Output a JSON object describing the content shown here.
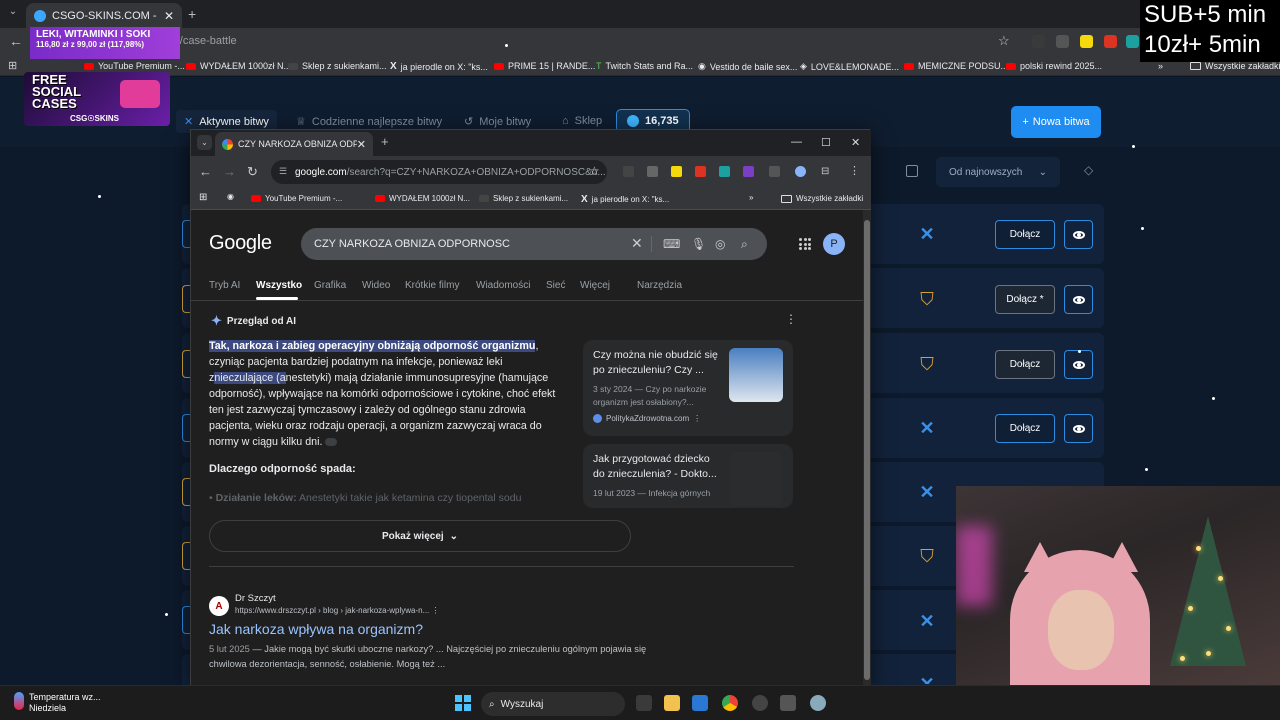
{
  "overlay": {
    "line1": "SUB+5 min",
    "line2": "10zł+ 5min"
  },
  "outer_browser": {
    "tab_title": "CSGO-SKINS.COM - Najlepsze",
    "url": "csgo-skins.com/case-battle",
    "bookmarks": [
      "YouTube Premium -...",
      "WYDAŁEM 1000zł N...",
      "Sklep z sukienkami...",
      "ja pierodle on X: \"ks...",
      "PRIME 15 | RANDE...",
      "Twitch Stats and Ra...",
      "Vestido de baile sex...",
      "LOVE&LEMONADE...",
      "MEMICZNE PODSU...",
      "polski rewind 2025..."
    ],
    "all_bookmarks": "Wszystkie zakładki"
  },
  "stream_banner": {
    "title": "LEKI, WITAMINKI I SOKI",
    "goal": "116,80 zł z 99,00 zł (117,98%)"
  },
  "promo": {
    "line1": "FREE",
    "line2": "SOCIAL",
    "line3": "CASES",
    "brand": "CSG☉SKINS"
  },
  "site": {
    "nav": [
      "Aktywne bitwy",
      "Codzienne najlepsze bitwy",
      "Moje bitwy",
      "Sklep"
    ],
    "balance": "16,735",
    "new_battle": "Nowa bitwa",
    "sort": "Od najnowszych",
    "join_label": "Dołącz",
    "join_label_alt": "Dołącz *"
  },
  "inner_browser": {
    "tab_title": "CZY NARKOZA OBNIZA ODPORNOSC",
    "url_host": "google.com",
    "url_path": "/search?q=CZY+NARKOZA+OBNIZA+ODPORNOSC&o...",
    "bookmarks": [
      "YouTube Premium -...",
      "WYDAŁEM 1000zł N...",
      "Sklep z sukienkami...",
      "ja pierodle on X: \"ks..."
    ],
    "all_bookmarks": "Wszystkie zakładki"
  },
  "google": {
    "logo": "Google",
    "query": "CZY NARKOZA OBNIZA ODPORNOSC",
    "avatar": "P",
    "tabs": [
      "Tryb AI",
      "Wszystko",
      "Grafika",
      "Wideo",
      "Krótkie filmy",
      "Wiadomości",
      "Sieć",
      "Więcej",
      "Narzędzia"
    ],
    "ai_overview": {
      "heading": "Przegląd od AI",
      "highlight": "Tak, narkoza i zabieg operacyjny obniżają odporność organizmu",
      "p1a": ", czyniąc pacjenta bardziej podatnym na infekcje, ponieważ leki z",
      "p1sel": "nieczulające (a",
      "p1b": "nestetyki) mają działanie immunosupresyjne (hamujące odporność), wpływające na komórki odpornościowe i cytokine, choć efekt ten jest zazwyczaj tymczasowy i zależy od ogólnego stanu zdrowia pacjenta, wieku oraz rodzaju operacji, a organizm zazwyczaj wraca do normy w ciągu kilku dni.",
      "subheading": "Dlaczego odporność spada:",
      "faded_bold": "Działanie leków:",
      "faded": " Anestetyki takie jak ketamina czy tiopental sodu",
      "show_more": "Pokaż więcej"
    },
    "sources": [
      {
        "title": "Czy można nie obudzić się po znieczuleniu? Czy ...",
        "meta": "3 sty 2024 — Czy po narkozie organizm jest osłabiony?...",
        "site": "PolitykaZdrowotna.com"
      },
      {
        "title": "Jak przygotować dziecko do znieczulenia? - Dokto...",
        "meta": "19 lut 2023 — Infekcja górnych",
        "site": ""
      }
    ],
    "result": {
      "site_name": "Dr Szczyt",
      "url": "https://www.drszczyt.pl › blog › jak-narkoza-wplywa-n...",
      "title": "Jak narkoza wpływa na organizm?",
      "date": "5 lut 2025",
      "snippet": " — Jakie mogą być skutki uboczne narkozy? ... Najczęściej po znieczuleniu ogólnym pojawia się chwilowa dezorientacja, senność, osłabienie. Mogą też ..."
    }
  },
  "taskbar": {
    "weather_title": "Temperatura wz...",
    "weather_sub": "Niedziela",
    "search": "Wyszukaj"
  }
}
